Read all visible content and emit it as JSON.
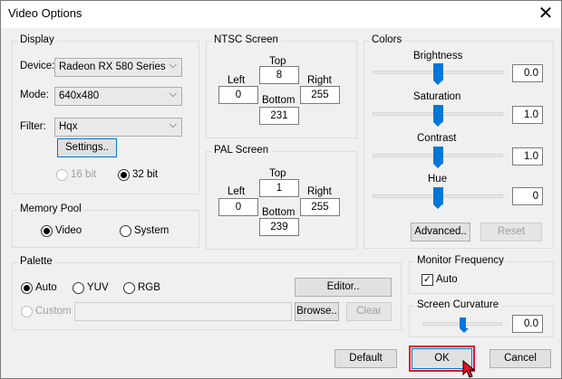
{
  "window": {
    "title": "Video Options"
  },
  "display": {
    "group_label": "Display",
    "device_label": "Device:",
    "device_value": "Radeon RX 580 Series",
    "mode_label": "Mode:",
    "mode_value": "640x480",
    "filter_label": "Filter:",
    "filter_value": "Hqx",
    "settings_button": "Settings..",
    "bit16_label": "16 bit",
    "bit32_label": "32 bit"
  },
  "ntsc": {
    "group_label": "NTSC Screen",
    "top_label": "Top",
    "top_value": "8",
    "left_label": "Left",
    "left_value": "0",
    "right_label": "Right",
    "right_value": "255",
    "bottom_label": "Bottom",
    "bottom_value": "231"
  },
  "pal": {
    "group_label": "PAL Screen",
    "top_label": "Top",
    "top_value": "1",
    "left_label": "Left",
    "left_value": "0",
    "right_label": "Right",
    "right_value": "255",
    "bottom_label": "Bottom",
    "bottom_value": "239"
  },
  "colors": {
    "group_label": "Colors",
    "brightness_label": "Brightness",
    "brightness_value": "0.0",
    "saturation_label": "Saturation",
    "saturation_value": "1.0",
    "contrast_label": "Contrast",
    "contrast_value": "1.0",
    "hue_label": "Hue",
    "hue_value": "0",
    "advanced_button": "Advanced..",
    "reset_button": "Reset"
  },
  "memory_pool": {
    "group_label": "Memory Pool",
    "video_label": "Video",
    "system_label": "System"
  },
  "palette": {
    "group_label": "Palette",
    "auto_label": "Auto",
    "yuv_label": "YUV",
    "rgb_label": "RGB",
    "custom_label": "Custom",
    "editor_button": "Editor..",
    "browse_button": "Browse..",
    "clear_button": "Clear"
  },
  "monitor": {
    "group_label": "Monitor Frequency",
    "auto_label": "Auto",
    "auto_mark": "✓"
  },
  "curvature": {
    "group_label": "Screen Curvature",
    "value": "0.0"
  },
  "footer": {
    "default_button": "Default",
    "ok_button": "OK",
    "cancel_button": "Cancel"
  },
  "icons": {
    "close": "close-icon",
    "dropdown": "chevron-down-icon",
    "cursor": "mouse-pointer-icon"
  },
  "colors_meta": {
    "accent": "#0078d7",
    "highlight": "#e81123"
  }
}
